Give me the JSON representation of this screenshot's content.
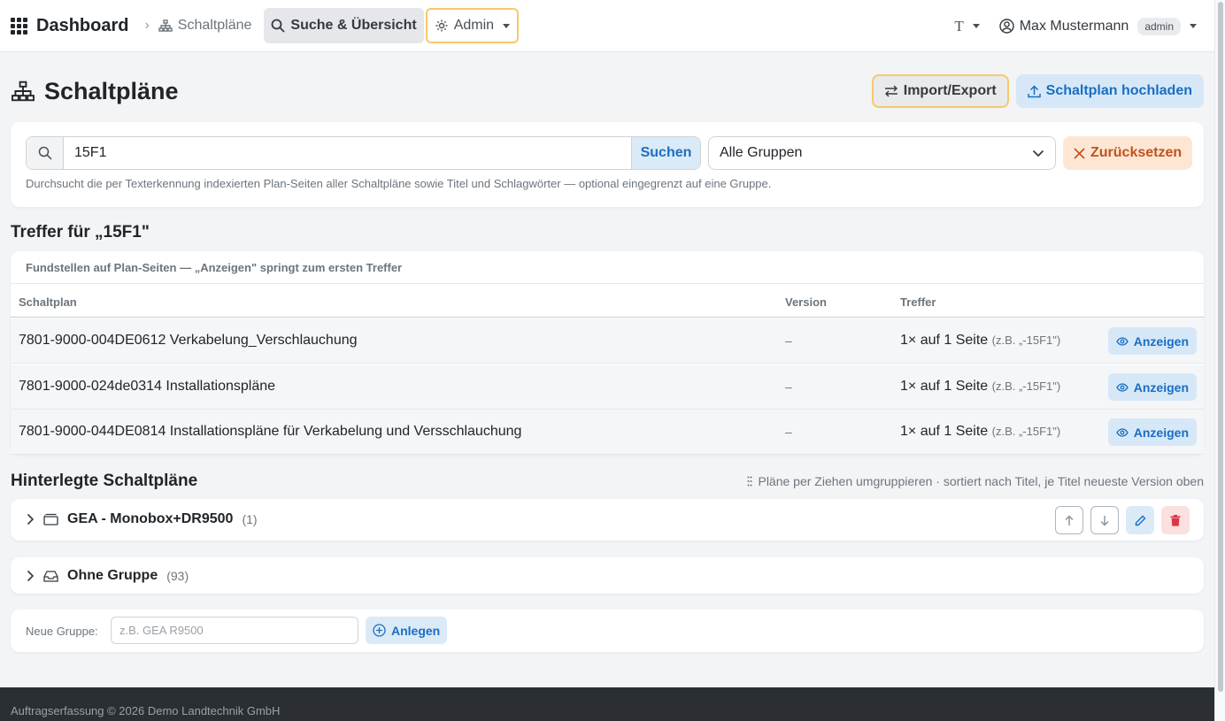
{
  "navbar": {
    "brand": "Dashboard",
    "breadcrumb": "Schaltpläne",
    "search_link": "Suche & Übersicht",
    "admin_menu": "Admin",
    "text_toggle": "T",
    "user_name": "Max Mustermann",
    "user_role": "admin"
  },
  "page": {
    "title": "Schaltpläne",
    "import_export_label": "Import/Export",
    "upload_label": "Schaltplan hochladen"
  },
  "search": {
    "query": "15F1",
    "search_button": "Suchen",
    "group_select": "Alle Gruppen",
    "reset_button": "Zurücksetzen",
    "help_text": "Durchsucht die per Texterkennung indexierten Plan-Seiten aller Schaltpläne sowie Titel und Schlagwörter — optional eingegrenzt auf eine Gruppe."
  },
  "results": {
    "heading": "Treffer für „15F1\"",
    "caption": "Fundstellen auf Plan-Seiten — „Anzeigen\" springt zum ersten Treffer",
    "columns": [
      "Schaltplan",
      "Version",
      "Treffer"
    ],
    "rows": [
      {
        "plan": "7801-9000-004DE0612 Verkabelung_Verschlauchung",
        "version": "–",
        "hits": "1× auf 1 Seite",
        "example": "(z.B. „-15F1\")",
        "action": "Anzeigen"
      },
      {
        "plan": "7801-9000-024de0314 Installationspläne",
        "version": "–",
        "hits": "1× auf 1 Seite",
        "example": "(z.B. „-15F1\")",
        "action": "Anzeigen"
      },
      {
        "plan": "7801-9000-044DE0814 Installationspläne für Verkabelung und Versschlauchung",
        "version": "–",
        "hits": "1× auf 1 Seite",
        "example": "(z.B. „-15F1\")",
        "action": "Anzeigen"
      }
    ]
  },
  "stored": {
    "heading": "Hinterlegte Schaltpläne",
    "sort_hint": "Pläne per Ziehen umgruppieren · sortiert nach Titel, je Titel neueste Version oben",
    "groups": [
      {
        "name": "GEA - Monobox+DR9500",
        "count": "(1)"
      },
      {
        "name": "Ohne Gruppe",
        "count": "(93)"
      }
    ],
    "new_group_label": "Neue Gruppe:",
    "new_group_placeholder": "z.B. GEA R9500",
    "create_button": "Anlegen"
  },
  "footer": {
    "text": "Auftragserfassung © 2026 Demo Landtechnik GmbH"
  },
  "colors": {
    "accent": "#1b6ec2",
    "warning_outline": "#f6c96a",
    "reset": "#c0531c",
    "danger": "#dc3545"
  }
}
